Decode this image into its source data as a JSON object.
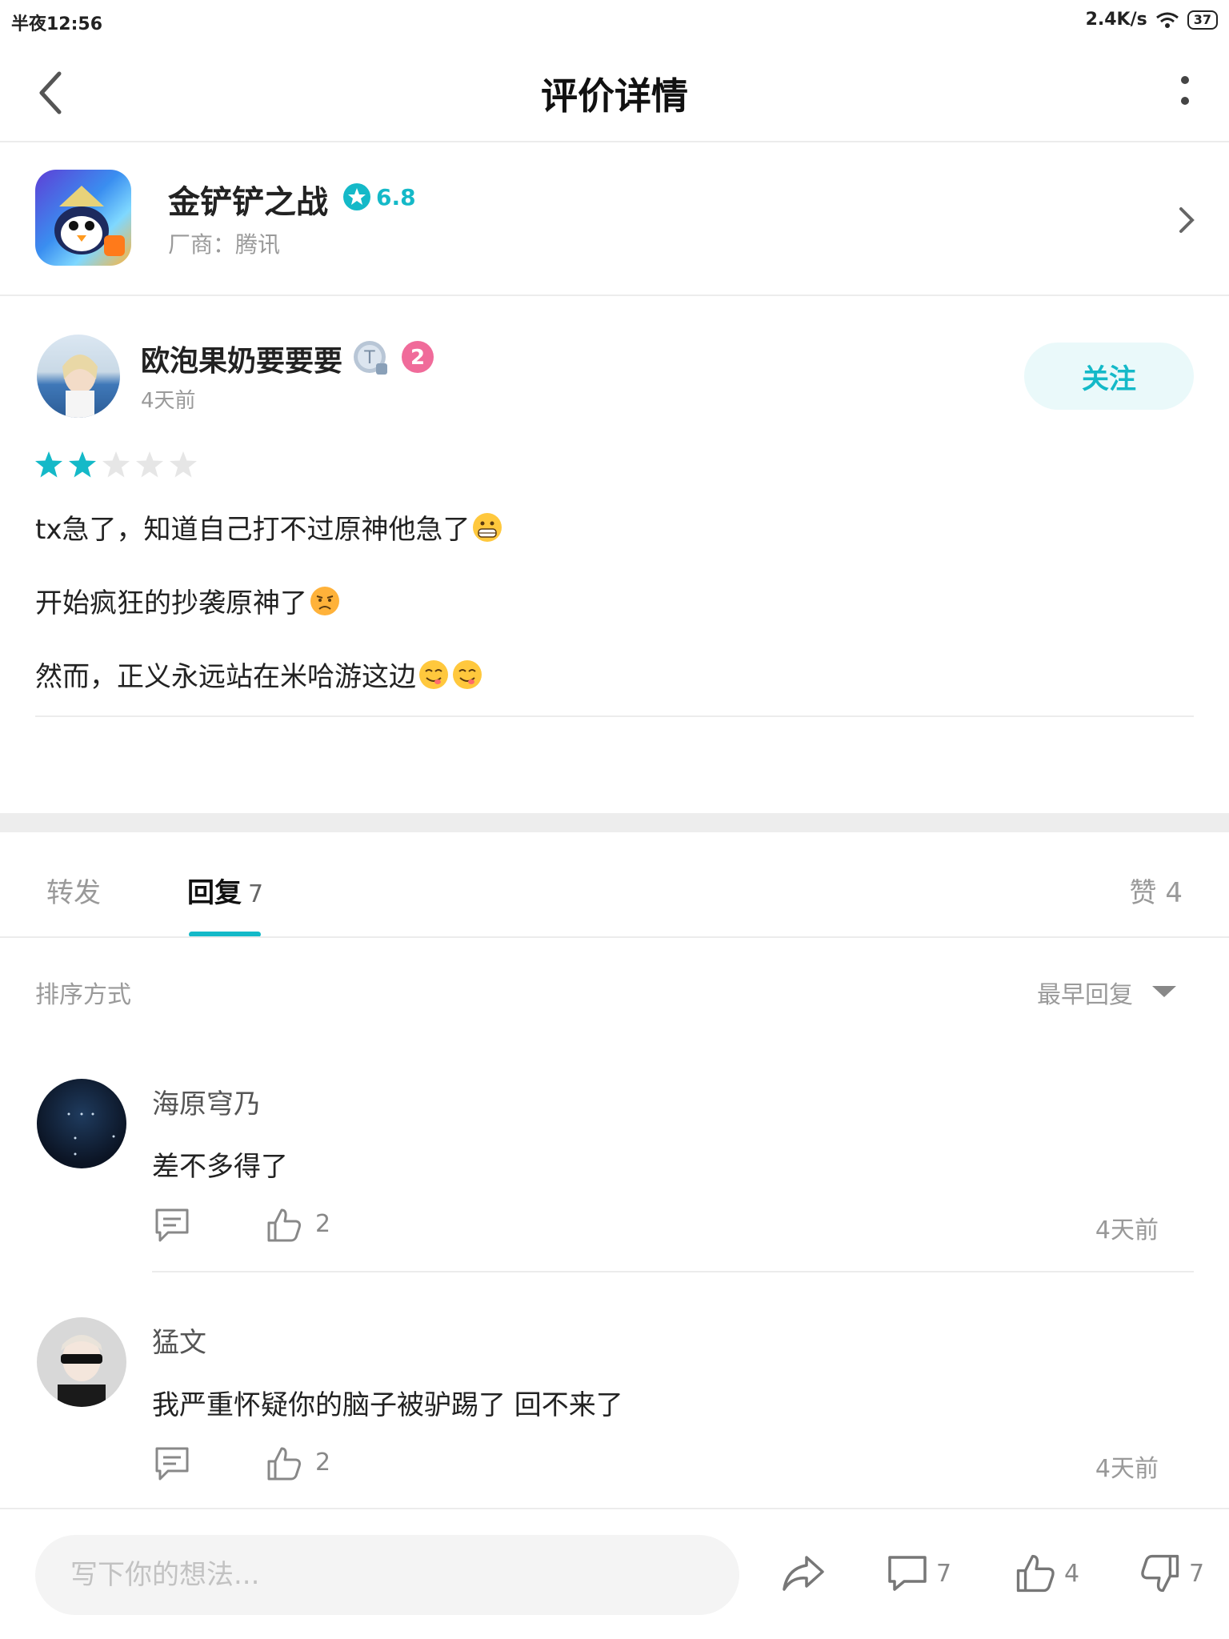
{
  "status_bar": {
    "time": "半夜12:56",
    "network_speed": "2.4K/s",
    "battery": "37"
  },
  "header": {
    "title": "评价详情"
  },
  "app": {
    "name": "金铲铲之战",
    "rating": "6.8",
    "vendor": "厂商：腾讯"
  },
  "review": {
    "user_name": "欧泡果奶要要要",
    "time": "4天前",
    "follow_label": "关注",
    "stars_filled": 2,
    "stars_total": 5,
    "lines": [
      "tx急了，知道自己打不过原神他急了",
      "开始疯狂的抄袭原神了",
      "然而，正义永远站在米哈游这边"
    ]
  },
  "tabs": {
    "forward": "转发",
    "reply": "回复",
    "reply_count": "7",
    "like": "赞",
    "like_count": "4"
  },
  "sort": {
    "label": "排序方式",
    "value": "最早回复"
  },
  "comments": [
    {
      "name": "海原穹乃",
      "text": "差不多得了",
      "likes": "2",
      "time": "4天前"
    },
    {
      "name": "猛文",
      "text": "我严重怀疑你的脑子被驴踢了 回不来了",
      "likes": "2",
      "time": "4天前"
    }
  ],
  "bottom_bar": {
    "placeholder": "写下你的想法...",
    "comment_count": "7",
    "like_count": "4",
    "dislike_count": "7"
  },
  "colors": {
    "accent": "#14b9c8",
    "divider": "#ececec"
  }
}
